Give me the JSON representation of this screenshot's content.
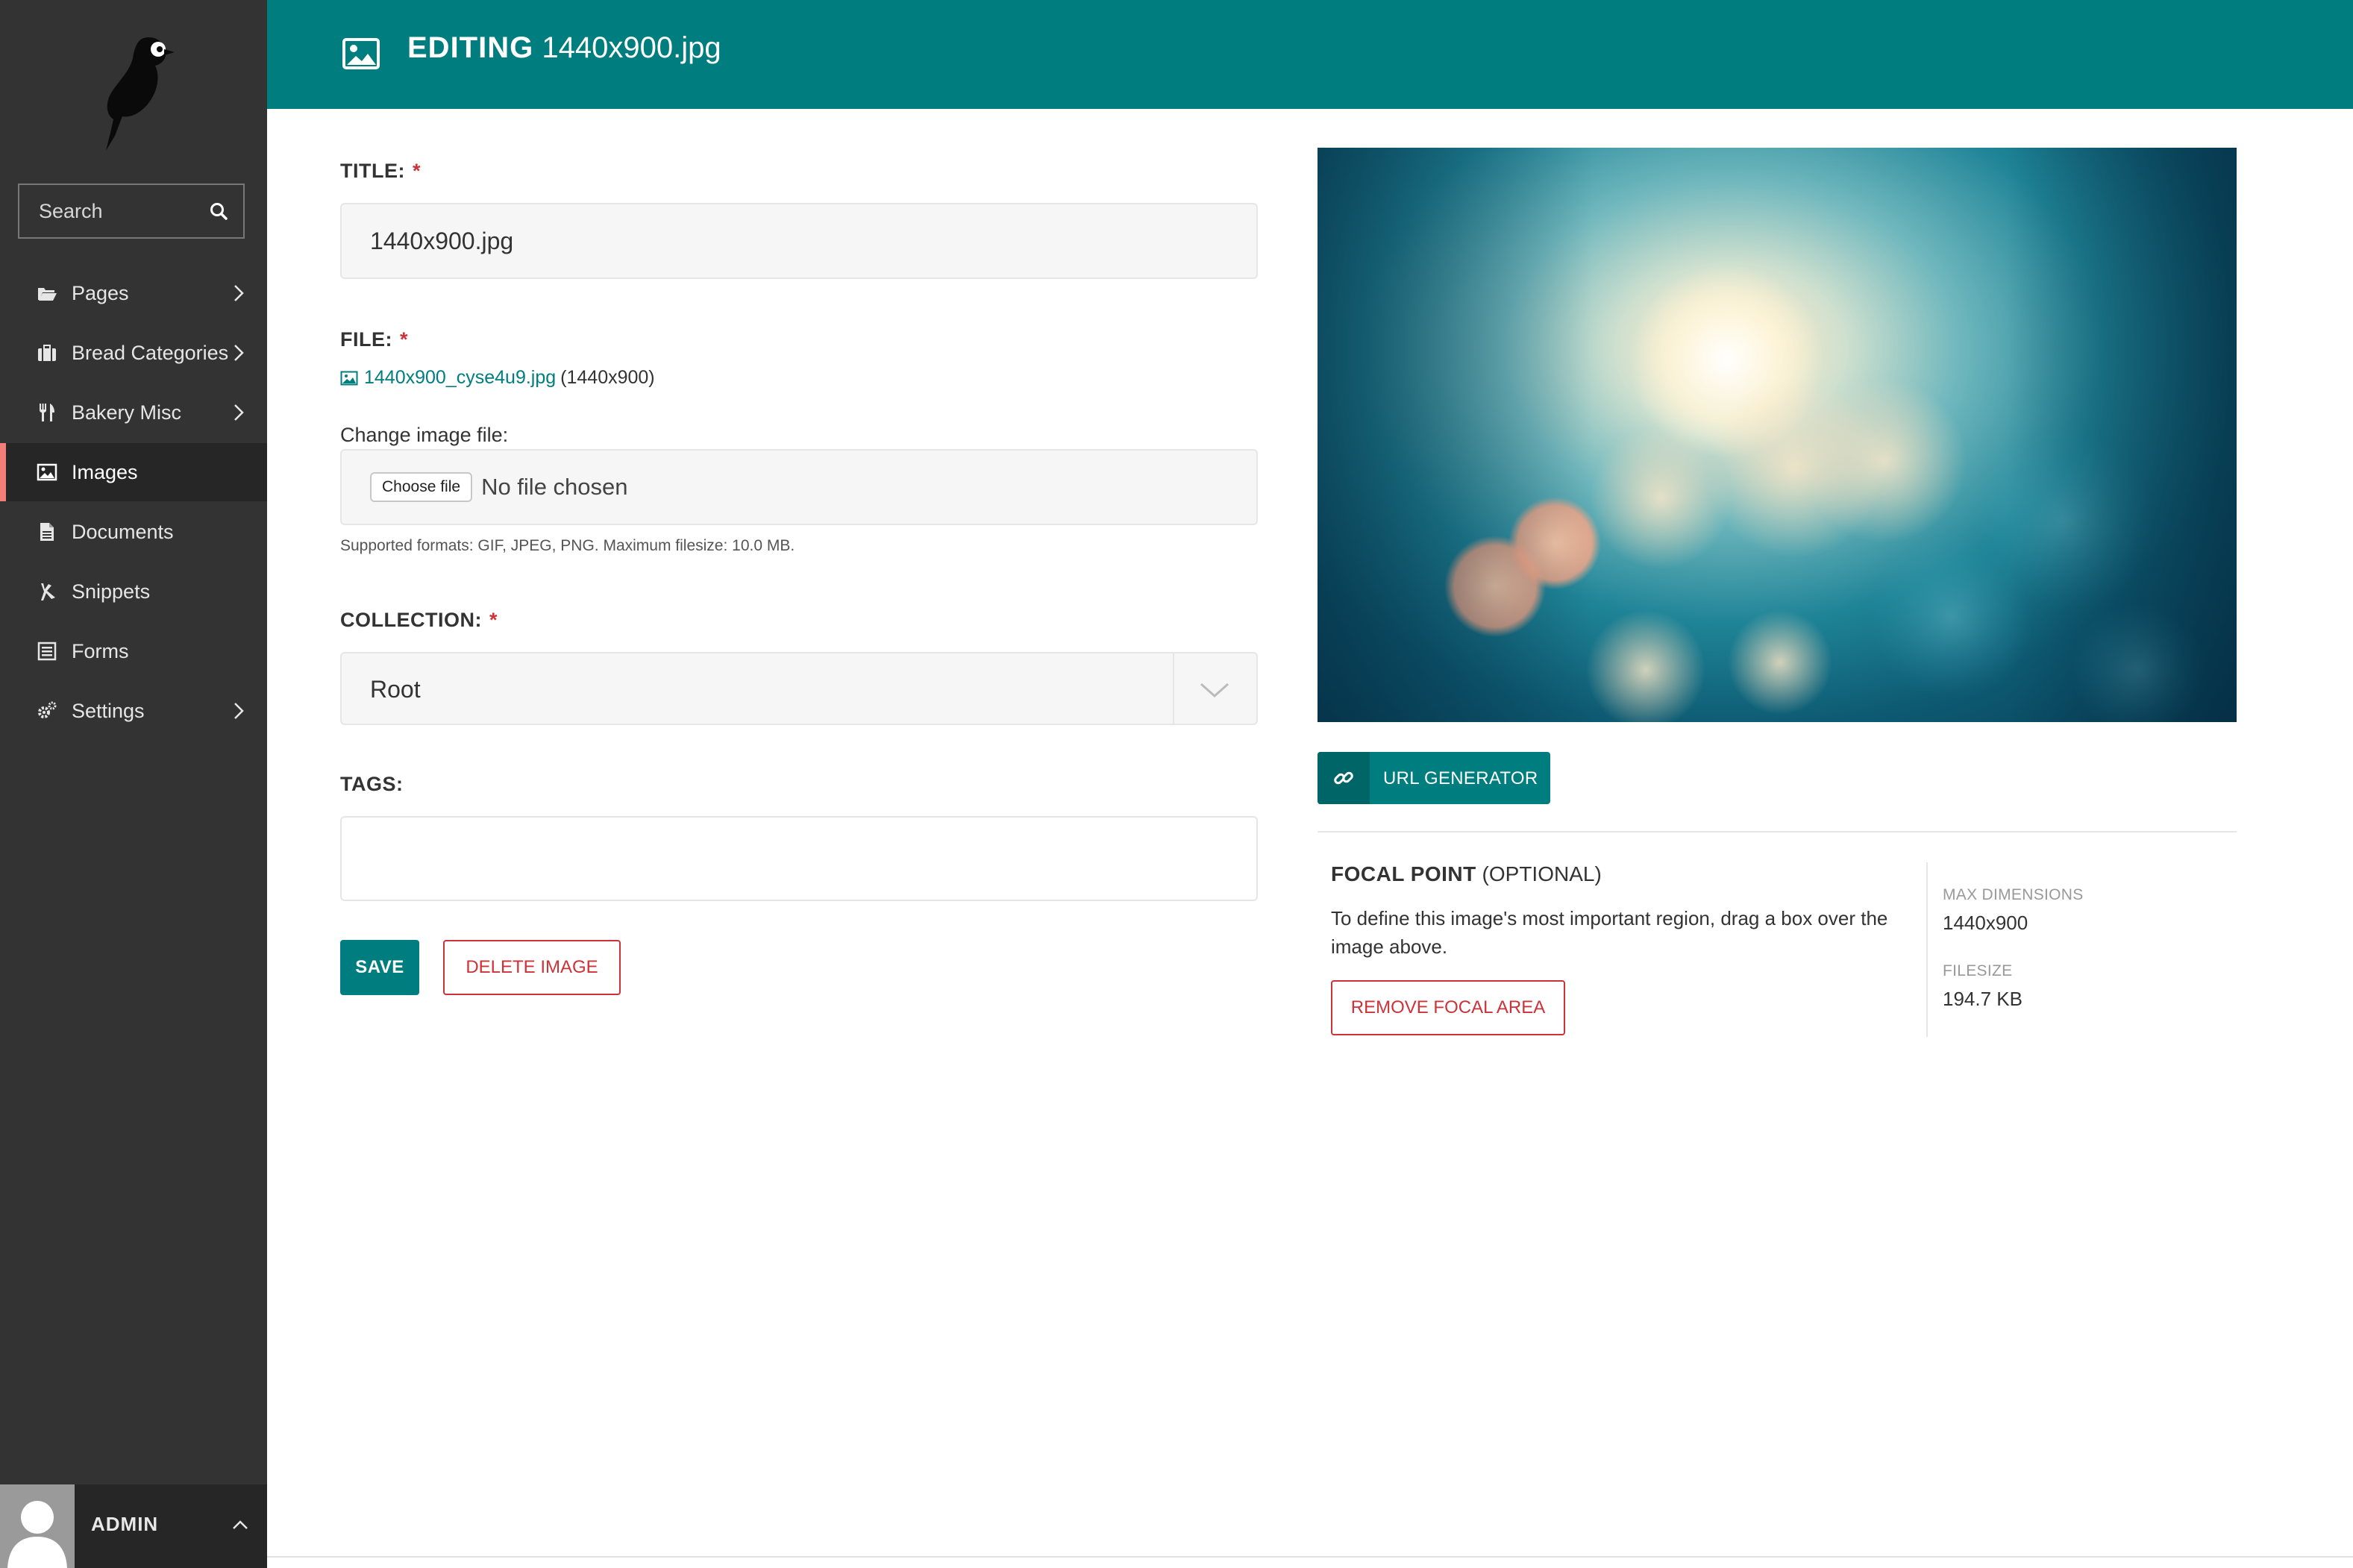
{
  "sidebar": {
    "search_label": "Search",
    "items": [
      {
        "label": "Pages",
        "icon": "folder-open-icon",
        "has_submenu": true
      },
      {
        "label": "Bread Categories",
        "icon": "suitcase-icon",
        "has_submenu": true
      },
      {
        "label": "Bakery Misc",
        "icon": "cutlery-icon",
        "has_submenu": true
      },
      {
        "label": "Images",
        "icon": "image-icon",
        "has_submenu": false,
        "active": true
      },
      {
        "label": "Documents",
        "icon": "document-icon",
        "has_submenu": false
      },
      {
        "label": "Snippets",
        "icon": "snippet-icon",
        "has_submenu": false
      },
      {
        "label": "Forms",
        "icon": "form-icon",
        "has_submenu": false
      },
      {
        "label": "Settings",
        "icon": "cogs-icon",
        "has_submenu": true
      }
    ],
    "account_name": "ADMIN"
  },
  "header": {
    "prefix": "EDITING",
    "filename": "1440x900.jpg"
  },
  "form": {
    "title_label": "TITLE:",
    "title_value": "1440x900.jpg",
    "file_label": "FILE:",
    "file_link": "1440x900_cyse4u9.jpg",
    "file_dims": "(1440x900)",
    "change_label": "Change image file:",
    "choose_button": "Choose file",
    "no_file": "No file chosen",
    "help_text": "Supported formats: GIF, JPEG, PNG. Maximum filesize: 10.0 MB.",
    "collection_label": "COLLECTION:",
    "collection_value": "Root",
    "tags_label": "TAGS:",
    "tags_value": "",
    "required_marker": "*",
    "save_button": "SAVE",
    "delete_button": "DELETE IMAGE"
  },
  "right": {
    "url_generator": "URL GENERATOR",
    "focal_title": "FOCAL POINT",
    "focal_optional": "(OPTIONAL)",
    "focal_desc": "To define this image's most important region, drag a box over the image above.",
    "remove_focal": "REMOVE FOCAL AREA",
    "max_dims_label": "MAX DIMENSIONS",
    "max_dims_value": "1440x900",
    "filesize_label": "FILESIZE",
    "filesize_value": "194.7 KB"
  },
  "colors": {
    "primary": "#007d7e",
    "sidebar": "#333333",
    "danger": "#cd3238",
    "active_marker": "#f37e77"
  }
}
